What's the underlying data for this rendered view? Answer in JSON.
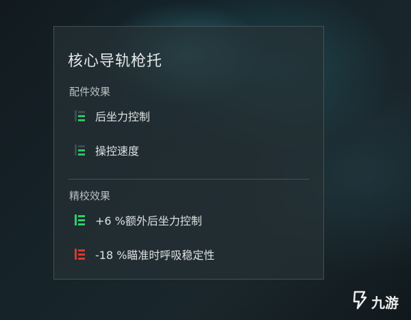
{
  "panel": {
    "title": "核心导轨枪托",
    "attachment_section": {
      "label": "配件效果",
      "items": [
        {
          "label": "后坐力控制",
          "icon": "stat-bars-icon"
        },
        {
          "label": "操控速度",
          "icon": "stat-bars-icon"
        }
      ]
    },
    "calibration_section": {
      "label": "精校效果",
      "items": [
        {
          "label": "+6 %额外后坐力控制",
          "icon": "increase-bars-icon",
          "color": "#2ecf6a"
        },
        {
          "label": "-18 %瞄准时呼吸稳定性",
          "icon": "decrease-bars-icon",
          "color": "#d63b34"
        }
      ]
    }
  },
  "colors": {
    "neutral_icon_dim": "#3e4c4d",
    "neutral_icon_green": "#2fc36a",
    "positive": "#2ecf6a",
    "negative": "#d63b34"
  },
  "watermark": {
    "text": "九游",
    "icon": "jiuyou-logo-icon"
  }
}
